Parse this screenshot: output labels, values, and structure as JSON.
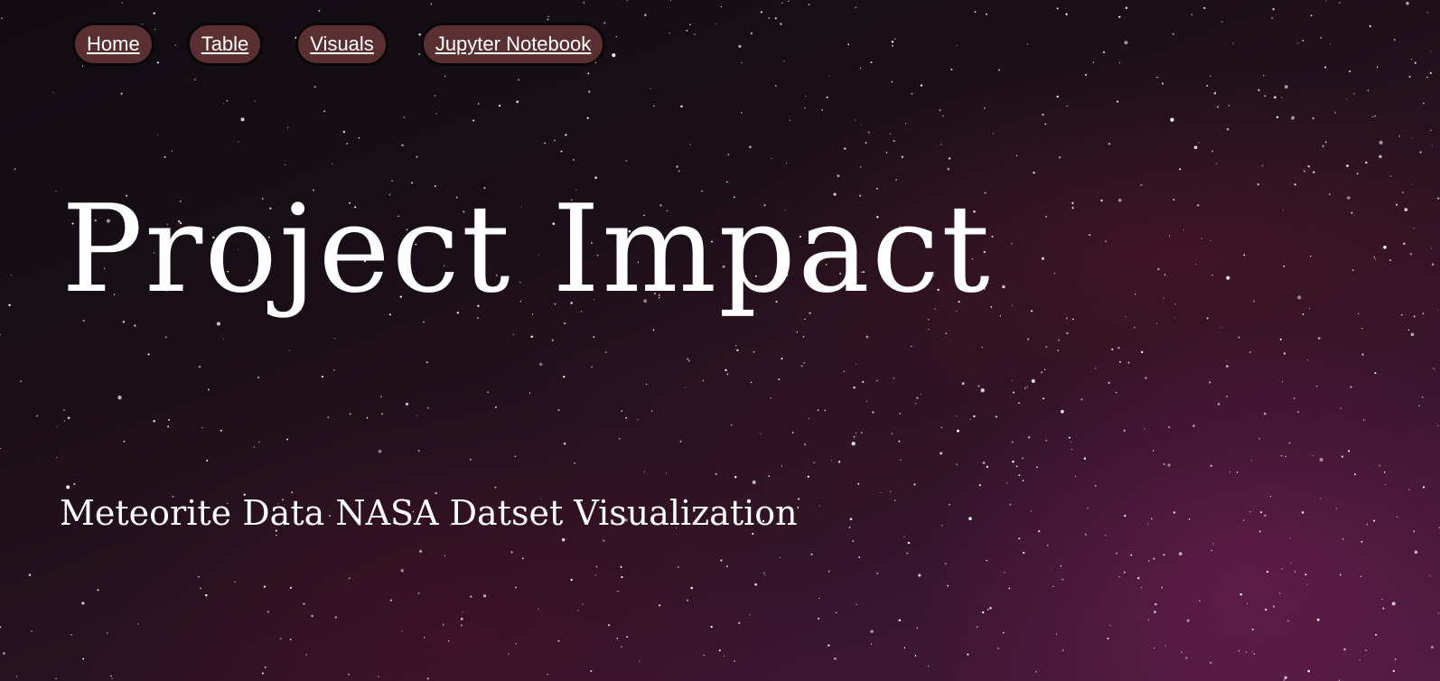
{
  "nav": {
    "items": [
      {
        "label": "Home"
      },
      {
        "label": "Table"
      },
      {
        "label": "Visuals"
      },
      {
        "label": "Jupyter Notebook"
      }
    ]
  },
  "hero": {
    "title": "Project Impact",
    "subtitle": "Meteorite Data NASA Datset Visualization"
  },
  "colors": {
    "nav_pill_bg": "#5a2f32",
    "nav_pill_border": "#0a0707",
    "text": "#ffffff",
    "sky_dark": "#120b12",
    "sky_purple": "#4a1a3e"
  }
}
